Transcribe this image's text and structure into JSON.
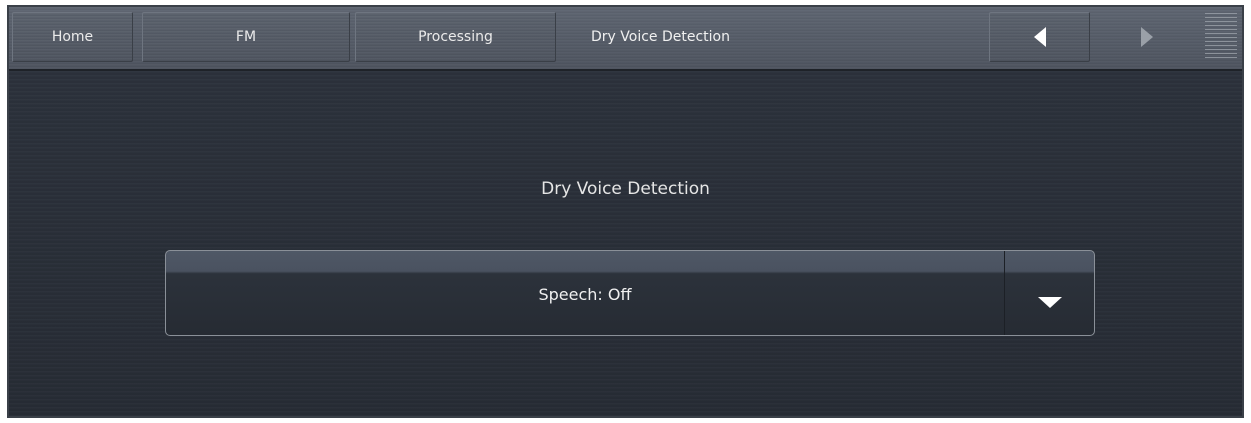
{
  "navbar": {
    "home_label": "Home",
    "fm_label": "FM",
    "processing_label": "Processing",
    "current_label": "Dry Voice Detection",
    "back_icon": "triangle-left-icon",
    "forward_icon": "triangle-right-icon",
    "menu_icon": "menu-lines-icon"
  },
  "main": {
    "title": "Dry Voice Detection",
    "dropdown": {
      "selected_value": "Speech: Off",
      "arrow_icon": "triangle-down-icon"
    }
  },
  "colors": {
    "background": "#2a303a",
    "navbar": "#5d6470",
    "text": "#eaeaea"
  }
}
